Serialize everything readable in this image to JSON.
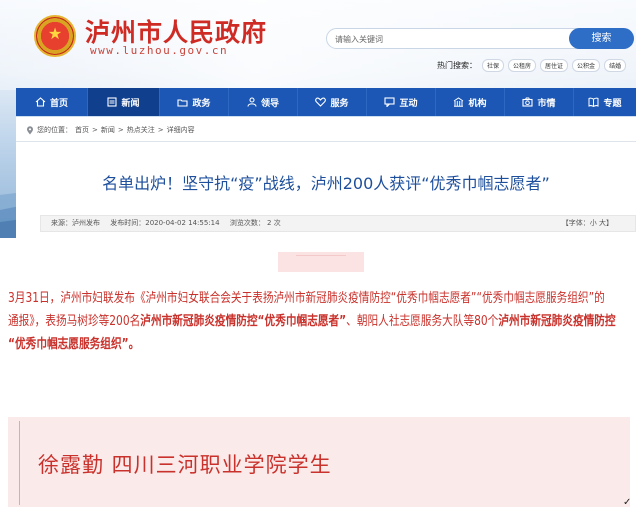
{
  "header": {
    "site_title": "泸州市人民政府",
    "domain": "www.luzhou.gov.cn",
    "search_placeholder": "请输入关键词",
    "search_button": "搜索",
    "hot_label": "热门搜索：",
    "hot_tags": [
      "社保",
      "公租房",
      "居住证",
      "公积金",
      "结婚"
    ]
  },
  "nav": {
    "items": [
      {
        "label": "首页",
        "icon": "home-icon"
      },
      {
        "label": "新闻",
        "icon": "news-icon",
        "active": true
      },
      {
        "label": "政务",
        "icon": "folder-icon"
      },
      {
        "label": "领导",
        "icon": "person-icon"
      },
      {
        "label": "服务",
        "icon": "heart-icon"
      },
      {
        "label": "互动",
        "icon": "chat-icon"
      },
      {
        "label": "机构",
        "icon": "building-icon"
      },
      {
        "label": "市情",
        "icon": "camera-icon"
      },
      {
        "label": "专题",
        "icon": "book-icon"
      }
    ]
  },
  "breadcrumb": {
    "prefix": "您的位置：",
    "items": [
      "首页",
      "新闻",
      "热点关注",
      "详细内容"
    ],
    "separator": ">"
  },
  "article": {
    "title": "名单出炉！坚守抗“疫”战线，泸州200人获评“优秀巾帼志愿者”",
    "source": "来源：泸州发布",
    "publish_time": "发布时间：2020-04-02 14:55:14",
    "views": "浏览次数：  2   次",
    "font_size": "【字体：小 大】"
  },
  "content": {
    "p1": "3月31日，泸州市妇联发布《泸州市妇女联合会关于表扬泸州市新冠肺炎疫情防控“优秀巾帼志愿者”“优秀巾帼志愿服务组织”的",
    "p2_a": "通报》，表扬马树珍等200名",
    "p2_b": "泸州市新冠肺炎疫情防控“优秀巾帼志愿者”",
    "p2_c": "、朝阳人社志愿服务大队等80个",
    "p2_d": "泸州市新冠肺炎疫情防控",
    "p3": "“优秀巾帼志愿服务组织”。",
    "card_name": "徐露勤 四川三河职业学院学生",
    "corner_mark": "✓"
  },
  "colors": {
    "nav_blue": "#1c57b5",
    "title_red": "#cf2b25",
    "article_red": "#c9322c",
    "title_blue": "#1d4f9c"
  }
}
